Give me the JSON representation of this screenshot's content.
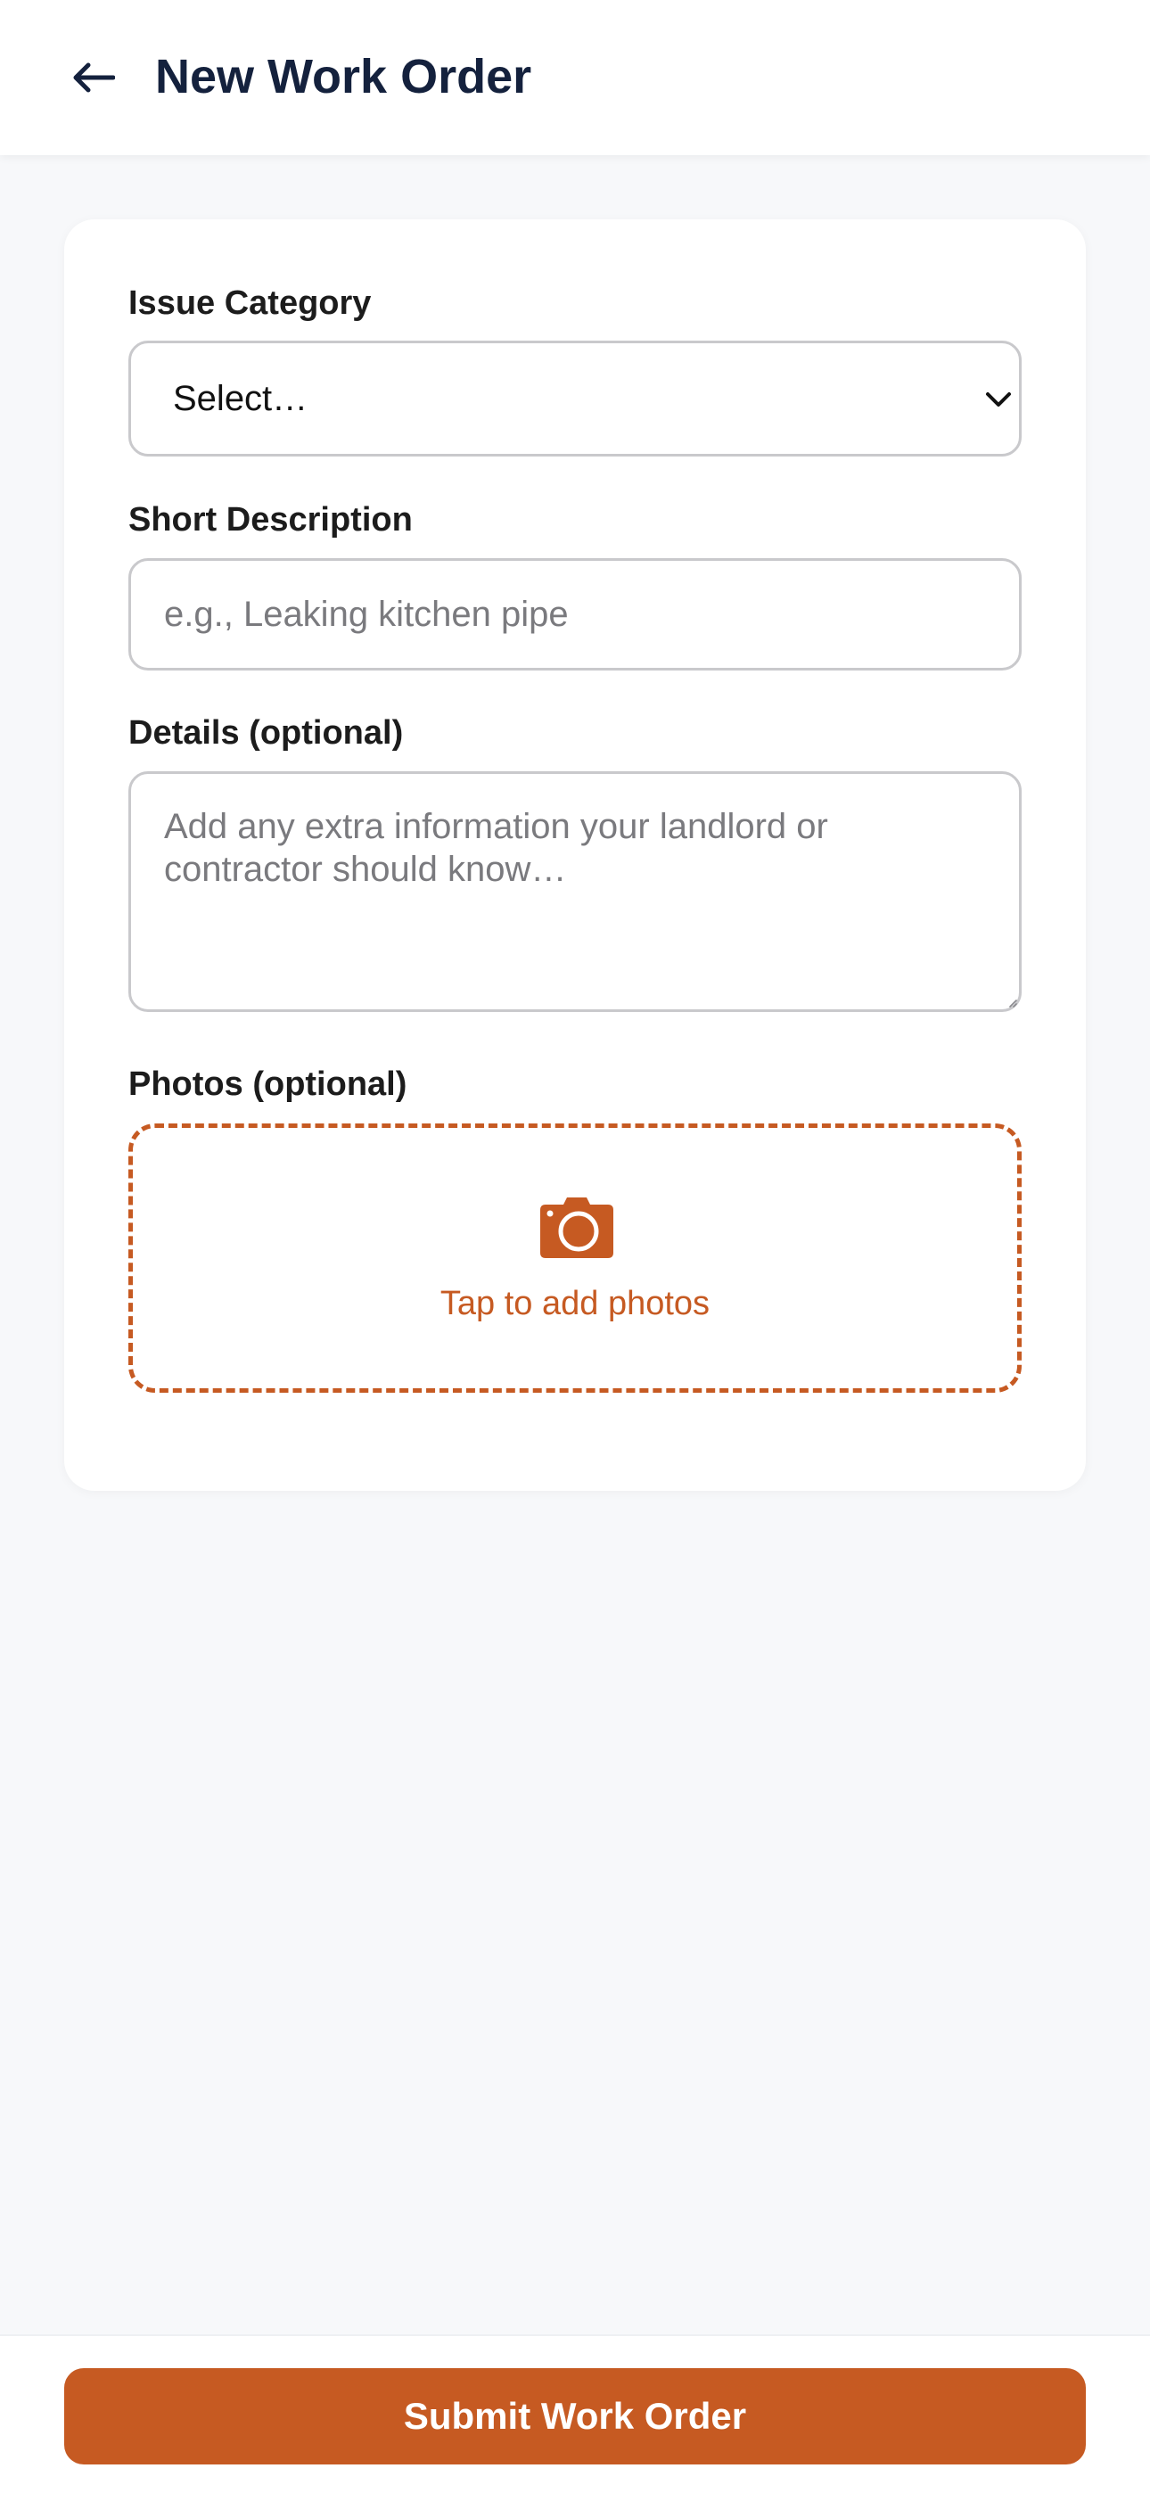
{
  "header": {
    "title": "New Work Order",
    "back_icon": "arrow-left-icon"
  },
  "form": {
    "issue_category": {
      "label": "Issue Category",
      "selected_value": "Select…"
    },
    "short_description": {
      "label": "Short Description",
      "placeholder": "e.g., Leaking kitchen pipe",
      "value": ""
    },
    "details": {
      "label": "Details (optional)",
      "placeholder": "Add any extra information your landlord or contractor should know…",
      "value": ""
    },
    "photos": {
      "label": "Photos (optional)",
      "upload_text": "Tap to add photos",
      "icon": "camera-icon"
    }
  },
  "footer": {
    "submit_label": "Submit Work Order"
  },
  "colors": {
    "accent": "#c65a22",
    "title": "#14213d",
    "background": "#f7f8fa"
  }
}
